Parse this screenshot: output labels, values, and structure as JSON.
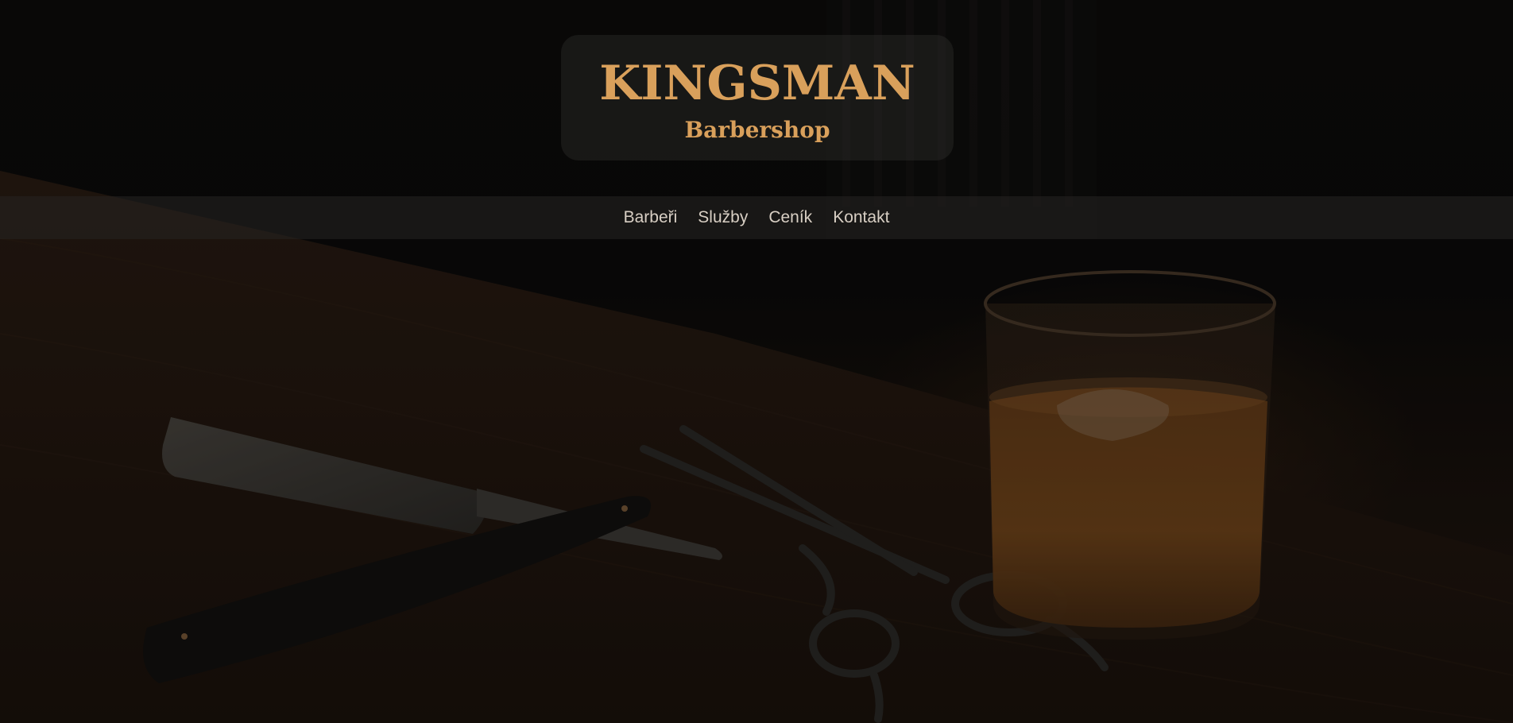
{
  "header": {
    "brand": "KINGSMAN",
    "tagline": "Barbershop"
  },
  "nav": {
    "items": [
      {
        "label": "Barbeři"
      },
      {
        "label": "Služby"
      },
      {
        "label": "Ceník"
      },
      {
        "label": "Kontakt"
      }
    ]
  },
  "colors": {
    "accent": "#d9a05b",
    "nav_text": "#d8cfc4",
    "background": "#0b0a09"
  },
  "hero": {
    "image": "barber-tools-still-life"
  }
}
